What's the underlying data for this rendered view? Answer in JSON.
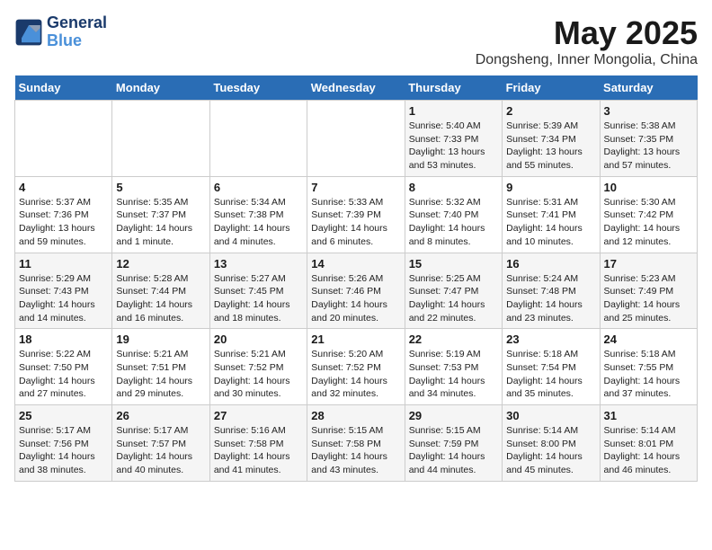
{
  "header": {
    "logo_line1": "General",
    "logo_line2": "Blue",
    "title": "May 2025",
    "subtitle": "Dongsheng, Inner Mongolia, China"
  },
  "calendar": {
    "weekdays": [
      "Sunday",
      "Monday",
      "Tuesday",
      "Wednesday",
      "Thursday",
      "Friday",
      "Saturday"
    ],
    "weeks": [
      [
        {
          "day": "",
          "info": ""
        },
        {
          "day": "",
          "info": ""
        },
        {
          "day": "",
          "info": ""
        },
        {
          "day": "",
          "info": ""
        },
        {
          "day": "1",
          "info": "Sunrise: 5:40 AM\nSunset: 7:33 PM\nDaylight: 13 hours\nand 53 minutes."
        },
        {
          "day": "2",
          "info": "Sunrise: 5:39 AM\nSunset: 7:34 PM\nDaylight: 13 hours\nand 55 minutes."
        },
        {
          "day": "3",
          "info": "Sunrise: 5:38 AM\nSunset: 7:35 PM\nDaylight: 13 hours\nand 57 minutes."
        }
      ],
      [
        {
          "day": "4",
          "info": "Sunrise: 5:37 AM\nSunset: 7:36 PM\nDaylight: 13 hours\nand 59 minutes."
        },
        {
          "day": "5",
          "info": "Sunrise: 5:35 AM\nSunset: 7:37 PM\nDaylight: 14 hours\nand 1 minute."
        },
        {
          "day": "6",
          "info": "Sunrise: 5:34 AM\nSunset: 7:38 PM\nDaylight: 14 hours\nand 4 minutes."
        },
        {
          "day": "7",
          "info": "Sunrise: 5:33 AM\nSunset: 7:39 PM\nDaylight: 14 hours\nand 6 minutes."
        },
        {
          "day": "8",
          "info": "Sunrise: 5:32 AM\nSunset: 7:40 PM\nDaylight: 14 hours\nand 8 minutes."
        },
        {
          "day": "9",
          "info": "Sunrise: 5:31 AM\nSunset: 7:41 PM\nDaylight: 14 hours\nand 10 minutes."
        },
        {
          "day": "10",
          "info": "Sunrise: 5:30 AM\nSunset: 7:42 PM\nDaylight: 14 hours\nand 12 minutes."
        }
      ],
      [
        {
          "day": "11",
          "info": "Sunrise: 5:29 AM\nSunset: 7:43 PM\nDaylight: 14 hours\nand 14 minutes."
        },
        {
          "day": "12",
          "info": "Sunrise: 5:28 AM\nSunset: 7:44 PM\nDaylight: 14 hours\nand 16 minutes."
        },
        {
          "day": "13",
          "info": "Sunrise: 5:27 AM\nSunset: 7:45 PM\nDaylight: 14 hours\nand 18 minutes."
        },
        {
          "day": "14",
          "info": "Sunrise: 5:26 AM\nSunset: 7:46 PM\nDaylight: 14 hours\nand 20 minutes."
        },
        {
          "day": "15",
          "info": "Sunrise: 5:25 AM\nSunset: 7:47 PM\nDaylight: 14 hours\nand 22 minutes."
        },
        {
          "day": "16",
          "info": "Sunrise: 5:24 AM\nSunset: 7:48 PM\nDaylight: 14 hours\nand 23 minutes."
        },
        {
          "day": "17",
          "info": "Sunrise: 5:23 AM\nSunset: 7:49 PM\nDaylight: 14 hours\nand 25 minutes."
        }
      ],
      [
        {
          "day": "18",
          "info": "Sunrise: 5:22 AM\nSunset: 7:50 PM\nDaylight: 14 hours\nand 27 minutes."
        },
        {
          "day": "19",
          "info": "Sunrise: 5:21 AM\nSunset: 7:51 PM\nDaylight: 14 hours\nand 29 minutes."
        },
        {
          "day": "20",
          "info": "Sunrise: 5:21 AM\nSunset: 7:52 PM\nDaylight: 14 hours\nand 30 minutes."
        },
        {
          "day": "21",
          "info": "Sunrise: 5:20 AM\nSunset: 7:52 PM\nDaylight: 14 hours\nand 32 minutes."
        },
        {
          "day": "22",
          "info": "Sunrise: 5:19 AM\nSunset: 7:53 PM\nDaylight: 14 hours\nand 34 minutes."
        },
        {
          "day": "23",
          "info": "Sunrise: 5:18 AM\nSunset: 7:54 PM\nDaylight: 14 hours\nand 35 minutes."
        },
        {
          "day": "24",
          "info": "Sunrise: 5:18 AM\nSunset: 7:55 PM\nDaylight: 14 hours\nand 37 minutes."
        }
      ],
      [
        {
          "day": "25",
          "info": "Sunrise: 5:17 AM\nSunset: 7:56 PM\nDaylight: 14 hours\nand 38 minutes."
        },
        {
          "day": "26",
          "info": "Sunrise: 5:17 AM\nSunset: 7:57 PM\nDaylight: 14 hours\nand 40 minutes."
        },
        {
          "day": "27",
          "info": "Sunrise: 5:16 AM\nSunset: 7:58 PM\nDaylight: 14 hours\nand 41 minutes."
        },
        {
          "day": "28",
          "info": "Sunrise: 5:15 AM\nSunset: 7:58 PM\nDaylight: 14 hours\nand 43 minutes."
        },
        {
          "day": "29",
          "info": "Sunrise: 5:15 AM\nSunset: 7:59 PM\nDaylight: 14 hours\nand 44 minutes."
        },
        {
          "day": "30",
          "info": "Sunrise: 5:14 AM\nSunset: 8:00 PM\nDaylight: 14 hours\nand 45 minutes."
        },
        {
          "day": "31",
          "info": "Sunrise: 5:14 AM\nSunset: 8:01 PM\nDaylight: 14 hours\nand 46 minutes."
        }
      ]
    ]
  }
}
